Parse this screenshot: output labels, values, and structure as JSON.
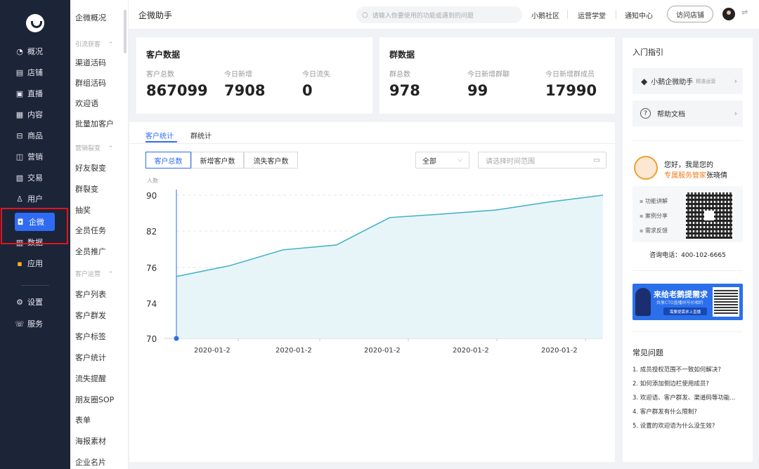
{
  "nav": {
    "items": [
      {
        "icon": "pie-chart-icon",
        "glyph": "◔",
        "label": "概况"
      },
      {
        "icon": "store-icon",
        "glyph": "▤",
        "label": "店铺"
      },
      {
        "icon": "live-icon",
        "glyph": "▣",
        "label": "直播"
      },
      {
        "icon": "content-icon",
        "glyph": "▦",
        "label": "内容"
      },
      {
        "icon": "goods-icon",
        "glyph": "⊟",
        "label": "商品"
      },
      {
        "icon": "marketing-icon",
        "glyph": "◫",
        "label": "营销"
      },
      {
        "icon": "trade-icon",
        "glyph": "▧",
        "label": "交易"
      },
      {
        "icon": "user-icon",
        "glyph": "♙",
        "label": "用户"
      },
      {
        "icon": "wecom-icon",
        "glyph": "◘",
        "label": "企微"
      },
      {
        "icon": "data-icon",
        "glyph": "▥",
        "label": "数据"
      },
      {
        "icon": "apps-icon",
        "glyph": "▪",
        "label": "应用"
      },
      {
        "icon": "settings-icon",
        "glyph": "⚙",
        "label": "设置"
      },
      {
        "icon": "service-icon",
        "glyph": "☏",
        "label": "服务"
      }
    ]
  },
  "sub": {
    "overview": "企微概况",
    "groups": [
      {
        "title": "引流获客",
        "items": [
          "渠道活码",
          "群组活码",
          "欢迎语",
          "批量加客户"
        ]
      },
      {
        "title": "营销裂变",
        "items": [
          "好友裂变",
          "群裂变",
          "抽奖",
          "全员任务",
          "全员推广"
        ]
      },
      {
        "title": "客户运营",
        "items": [
          "客户列表",
          "客户群发",
          "客户标签",
          "客户统计",
          "流失提醒",
          "朋友圈SOP",
          "表单",
          "海报素材",
          "企业名片"
        ]
      }
    ]
  },
  "header": {
    "title": "企微助手",
    "search_placeholder": "请输入你要使用的功能或遇到的问题",
    "links": [
      "小鹅社区",
      "运营学堂",
      "通知中心"
    ],
    "visit": "访问店铺"
  },
  "customer": {
    "title": "客户数据",
    "stats": [
      {
        "label": "客户总数",
        "value": "867099"
      },
      {
        "label": "今日新增",
        "value": "7908"
      },
      {
        "label": "今日流失",
        "value": "0"
      }
    ]
  },
  "group": {
    "title": "群数据",
    "stats": [
      {
        "label": "群总数",
        "value": "978"
      },
      {
        "label": "今日新增群聊",
        "value": "99"
      },
      {
        "label": "今日新增群成员",
        "value": "17990"
      }
    ]
  },
  "tabs": [
    "客户统计",
    "群统计"
  ],
  "segments": [
    "客户总数",
    "新增客户数",
    "流失客户数"
  ],
  "filter": {
    "value": "全部",
    "date_placeholder": "请选择时间范围"
  },
  "chart_data": {
    "type": "area",
    "ylabel": "人数",
    "ylim": [
      70,
      90
    ],
    "y_ticks": [
      70,
      74,
      76,
      82,
      90
    ],
    "x_tick_labels": [
      "2020-01-2",
      "2020-01-2",
      "2020-01-2",
      "2020-01-2",
      "2020-01-2"
    ],
    "values": [
      75.5,
      76.3,
      78.9,
      79.7,
      85.0,
      85.8,
      86.7,
      88.5,
      90.0
    ],
    "color": "#48b3c9"
  },
  "right": {
    "guide_title": "入门指引",
    "assistant_name": "小鹅企微助手",
    "assistant_tag": "精准运营",
    "help": "帮助文档",
    "greeting": "您好，我是您的",
    "manager_role": "专属服务管家",
    "manager_name": "张晓倩",
    "bullets": [
      "功能讲解",
      "案例分享",
      "需求反馈"
    ],
    "phone": "咨询电话：400-102-6665",
    "banner_title": "来给老鹅提需求",
    "banner_sub": "共享CTO直播间号价相约",
    "banner_btn": "需要提需求上直播",
    "faq_title": "常见问题",
    "faqs": [
      "1. 成员授权范围不一致如何解决?",
      "2. 如何添加侧边栏使用成员?",
      "3. 欢迎语、客户群发、渠道码等功能...",
      "4. 客户群发有什么限制?",
      "5. 设置的欢迎语为什么没生效?"
    ]
  },
  "colors": {
    "nav_bg": "#1c2438",
    "accent": "#2f6bf2",
    "highlight": "#e0161e",
    "manager": "#f07d1a"
  }
}
